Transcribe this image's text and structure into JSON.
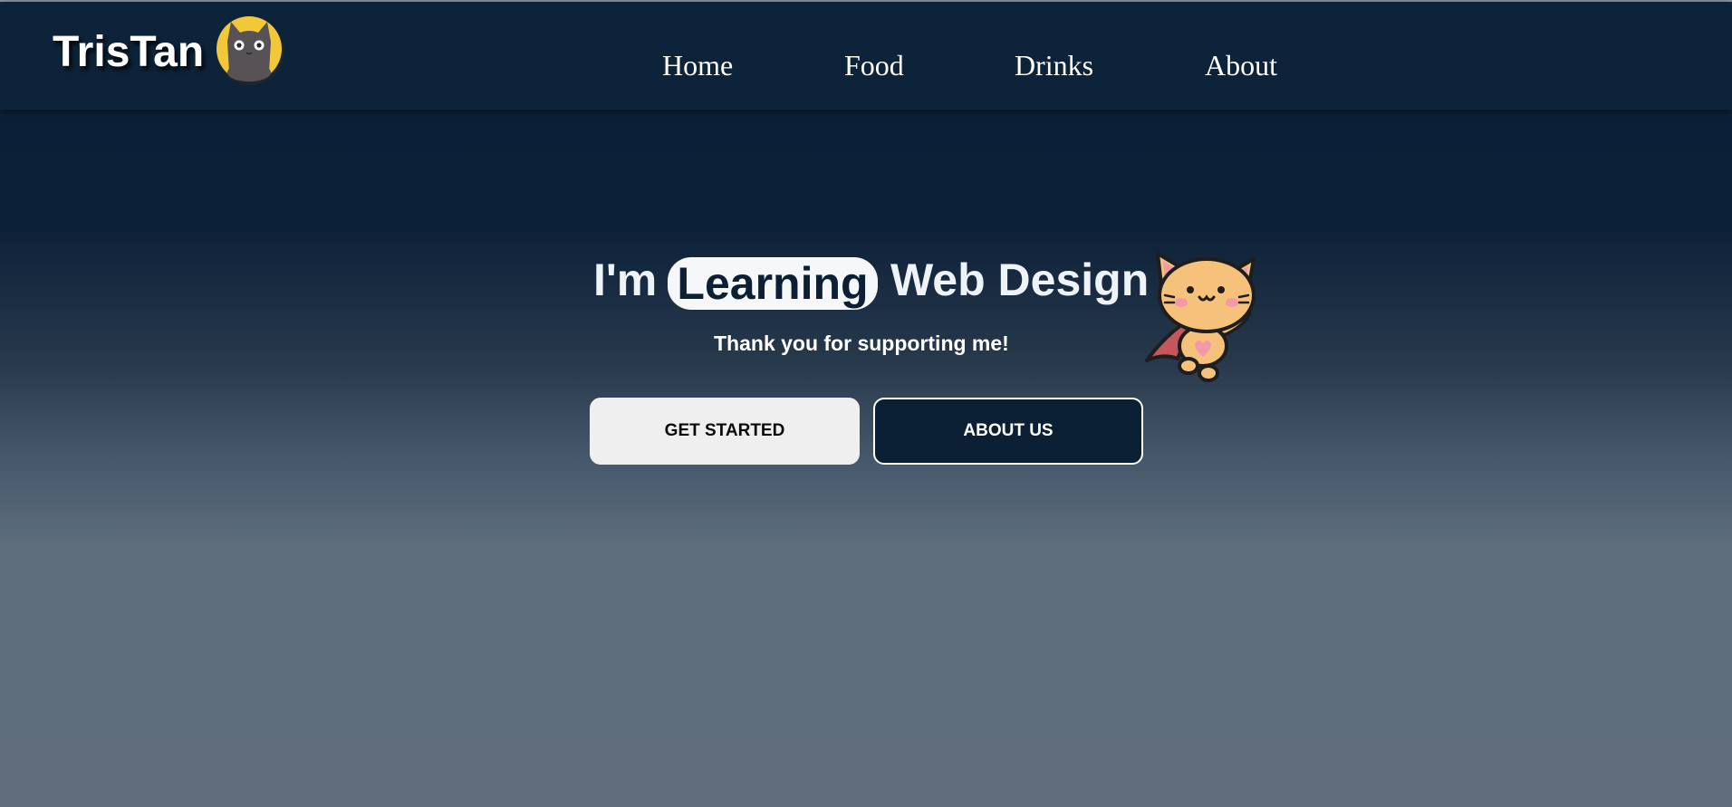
{
  "brand": {
    "name": "TrisTan",
    "logo_icon": "cat-logo-icon"
  },
  "nav": {
    "items": [
      {
        "label": "Home"
      },
      {
        "label": "Food"
      },
      {
        "label": "Drinks"
      },
      {
        "label": "About"
      }
    ]
  },
  "hero": {
    "title_prefix": "I'm",
    "title_highlight": "Learning",
    "title_suffix": "Web Design",
    "subtitle": "Thank you for supporting me!",
    "mascot_icon": "flying-cat-mascot-icon"
  },
  "buttons": {
    "primary_label": "GET STARTED",
    "secondary_label": "ABOUT US"
  },
  "colors": {
    "navbar": "#0d2339",
    "accent_dark": "#0b1f35",
    "button_light": "#efefef",
    "logo_yellow": "#f2c83a"
  }
}
